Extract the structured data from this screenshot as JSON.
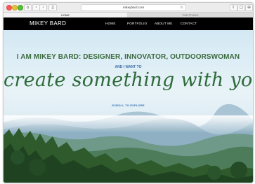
{
  "browser": {
    "url": "mikeybard.com",
    "tabs": [
      {
        "label": "HOME"
      },
      {
        "label": "PORTFOLIO"
      }
    ]
  },
  "site": {
    "brand": "MIKEY BARD",
    "nav": [
      "HOME",
      "PORTFOLIO",
      "ABOUT ME",
      "CONTACT"
    ],
    "headline": "I AM MIKEY BARD: DESIGNER, INNOVATOR, OUTDOORSWOMAN",
    "subheadline": "AND I WANT TO",
    "script_line": "create something with you",
    "scroll_label": "SCROLL TO EXPLORE"
  },
  "colors": {
    "nav_bg": "#000000",
    "headline": "#3b6b3e",
    "script": "#2f6b3a",
    "accent_blue": "#2f6db0"
  }
}
